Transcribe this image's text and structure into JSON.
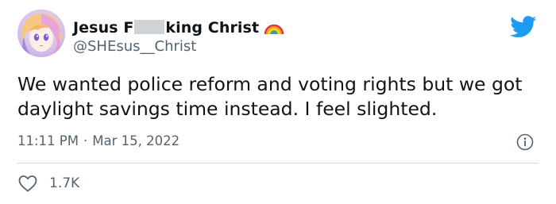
{
  "author": {
    "name_prefix": "Jesus F",
    "name_suffix": "king Christ",
    "handle": "@SHEsus__Christ",
    "avatar_icon": "anime-avatar-icon",
    "badge_icon": "rainbow-icon"
  },
  "tweet": {
    "text": "We wanted police reform and voting rights but we got daylight savings time instead. I feel slighted.",
    "time": "11:11 PM",
    "separator": "·",
    "date": "Mar 15, 2022"
  },
  "engagement": {
    "likes": "1.7K",
    "like_icon": "heart-icon"
  },
  "colors": {
    "twitter_blue": "#1d9bf0",
    "text_primary": "#0f1419",
    "text_secondary": "#536471",
    "divider": "#cfd9de"
  }
}
